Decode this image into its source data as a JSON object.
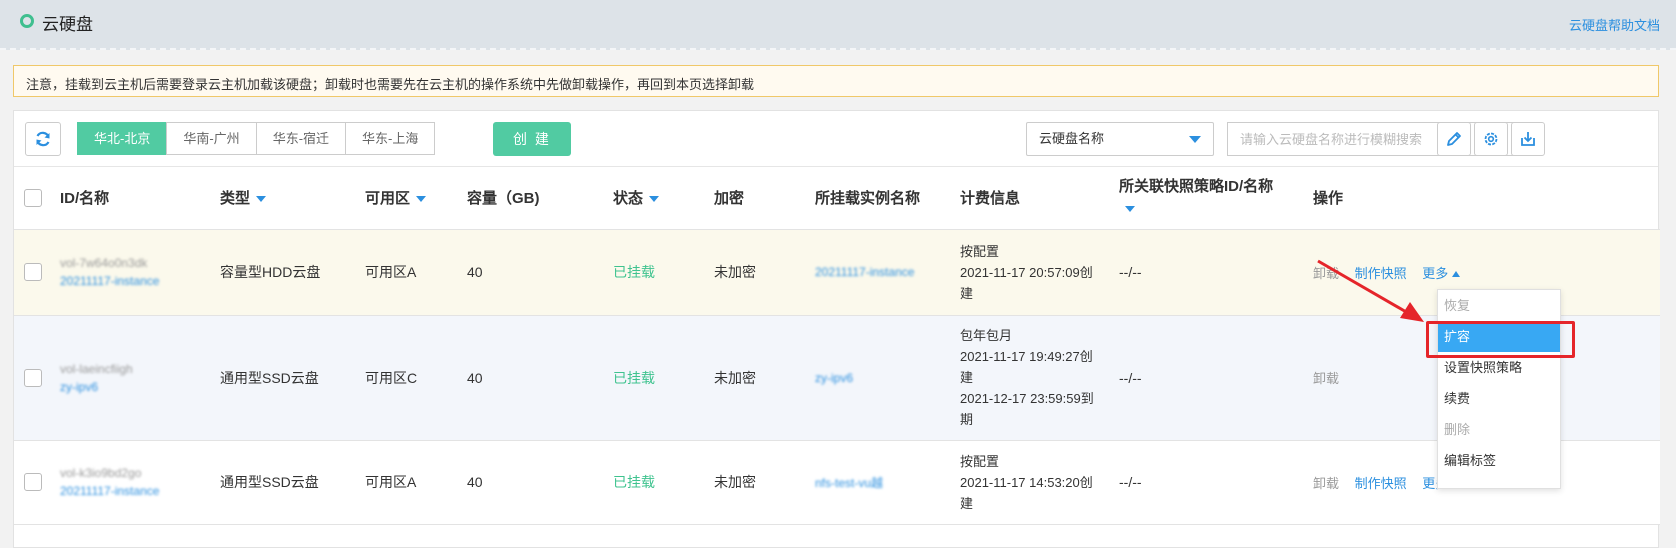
{
  "header": {
    "title": "云硬盘",
    "help_link": "云硬盘帮助文档"
  },
  "notice": "注意，挂载到云主机后需要登录云主机加载该硬盘；卸载时也需要先在云主机的操作系统中先做卸载操作，再回到本页选择卸载",
  "toolbar": {
    "regions": [
      "华北-北京",
      "华南-广州",
      "华东-宿迁",
      "华东-上海"
    ],
    "active_region": "华北-北京",
    "create_label": "创 建",
    "search_field": "云硬盘名称",
    "search_placeholder": "请输入云硬盘名称进行模糊搜索"
  },
  "table": {
    "columns": [
      "ID/名称",
      "类型",
      "可用区",
      "容量（GB)",
      "状态",
      "加密",
      "所挂载实例名称",
      "计费信息",
      "所关联快照策略ID/名称",
      "操作"
    ],
    "rows": [
      {
        "id": "vol-7w64o0n3dk",
        "name": "20211117-instance",
        "type": "容量型HDD云盘",
        "zone": "可用区A",
        "capacity": "40",
        "status": "已挂载",
        "encryption": "未加密",
        "instance": "20211117-instance",
        "billing": [
          "按配置",
          "2021-11-17 20:57:09创",
          "建"
        ],
        "snapshot_policy": "--/--",
        "ops": [
          "卸载",
          "制作快照",
          "更多"
        ]
      },
      {
        "id": "vol-laeincfiigh",
        "name": "zy-ipv6",
        "type": "通用型SSD云盘",
        "zone": "可用区C",
        "capacity": "40",
        "status": "已挂载",
        "encryption": "未加密",
        "instance": "zy-ipv6",
        "billing": [
          "包年包月",
          "2021-11-17 19:49:27创",
          "建",
          "2021-12-17 23:59:59到",
          "期"
        ],
        "snapshot_policy": "--/--",
        "ops": [
          "卸载"
        ]
      },
      {
        "id": "vol-k3io9bd2go",
        "name": "20211117-instance",
        "type": "通用型SSD云盘",
        "zone": "可用区A",
        "capacity": "40",
        "status": "已挂载",
        "encryption": "未加密",
        "instance": "nfs-test-vu越",
        "billing": [
          "按配置",
          "2021-11-17 14:53:20创",
          "建"
        ],
        "snapshot_policy": "--/--",
        "ops": [
          "卸载",
          "制作快照",
          "更多"
        ]
      }
    ]
  },
  "dropdown": {
    "items": [
      {
        "label": "恢复",
        "state": "disabled"
      },
      {
        "label": "扩容",
        "state": "active"
      },
      {
        "label": "设置快照策略",
        "state": "normal"
      },
      {
        "label": "续费",
        "state": "normal"
      },
      {
        "label": "删除",
        "state": "disabled"
      },
      {
        "label": "编辑标签",
        "state": "normal"
      }
    ]
  },
  "colors": {
    "accent_green": "#51cba2",
    "link_blue": "#2b8fdf",
    "status_green": "#3fc38f",
    "highlight_red": "#e5252a",
    "menu_active_blue": "#38a8f3"
  }
}
